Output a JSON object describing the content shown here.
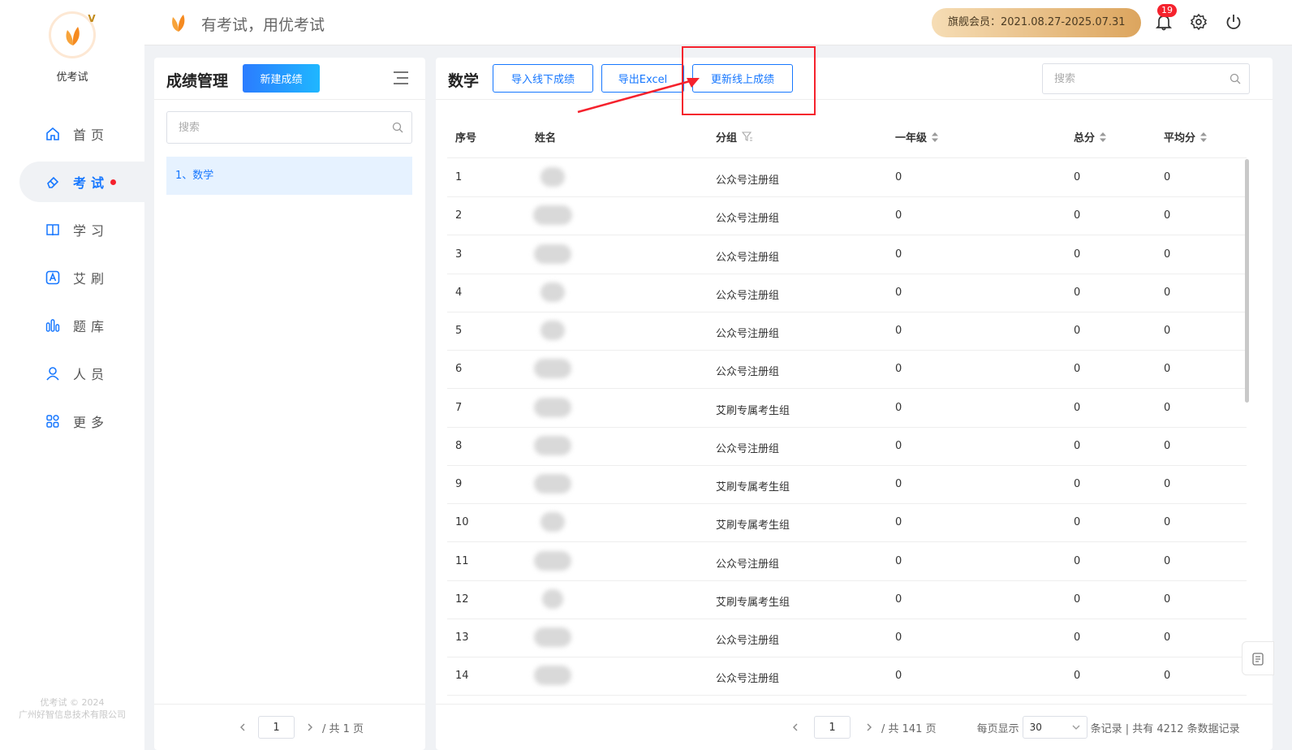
{
  "app": {
    "name": "优考试",
    "slogan": "有考试，用优考试",
    "logo_badge": "V"
  },
  "sidebar": {
    "items": [
      {
        "label": "首页",
        "icon": "home-icon"
      },
      {
        "label": "考试",
        "icon": "eraser-icon",
        "active": true,
        "dot": true
      },
      {
        "label": "学习",
        "icon": "book-icon"
      },
      {
        "label": "艾刷",
        "icon": "a-badge-icon"
      },
      {
        "label": "题库",
        "icon": "bars-icon"
      },
      {
        "label": "人员",
        "icon": "user-icon"
      },
      {
        "label": "更多",
        "icon": "apps-icon"
      }
    ],
    "footer_line1": "优考试 © 2024",
    "footer_line2": "广州好智信息技术有限公司"
  },
  "topbar": {
    "member_text": "旗舰会员：2021.08.27-2025.07.31",
    "notification_count": "19"
  },
  "left_panel": {
    "title": "成绩管理",
    "new_button": "新建成绩",
    "search_placeholder": "搜索",
    "exam_list": [
      "1、数学"
    ],
    "pager": {
      "page": "1",
      "total": "/ 共 1 页"
    }
  },
  "right_panel": {
    "title": "数学",
    "buttons": {
      "import": "导入线下成绩",
      "export": "导出Excel",
      "update": "更新线上成绩"
    },
    "search_placeholder": "搜索",
    "columns": [
      "序号",
      "姓名",
      "分组",
      "一年级",
      "总分",
      "平均分"
    ],
    "rows": [
      {
        "no": "1",
        "group": "公众号注册组",
        "grade1": "0",
        "total": "0",
        "avg": "0"
      },
      {
        "no": "2",
        "group": "公众号注册组",
        "grade1": "0",
        "total": "0",
        "avg": "0"
      },
      {
        "no": "3",
        "group": "公众号注册组",
        "grade1": "0",
        "total": "0",
        "avg": "0"
      },
      {
        "no": "4",
        "group": "公众号注册组",
        "grade1": "0",
        "total": "0",
        "avg": "0"
      },
      {
        "no": "5",
        "group": "公众号注册组",
        "grade1": "0",
        "total": "0",
        "avg": "0"
      },
      {
        "no": "6",
        "group": "公众号注册组",
        "grade1": "0",
        "total": "0",
        "avg": "0"
      },
      {
        "no": "7",
        "group": "艾刷专属考生组",
        "grade1": "0",
        "total": "0",
        "avg": "0"
      },
      {
        "no": "8",
        "group": "公众号注册组",
        "grade1": "0",
        "total": "0",
        "avg": "0"
      },
      {
        "no": "9",
        "group": "艾刷专属考生组",
        "grade1": "0",
        "total": "0",
        "avg": "0"
      },
      {
        "no": "10",
        "group": "艾刷专属考生组",
        "grade1": "0",
        "total": "0",
        "avg": "0"
      },
      {
        "no": "11",
        "group": "公众号注册组",
        "grade1": "0",
        "total": "0",
        "avg": "0"
      },
      {
        "no": "12",
        "group": "艾刷专属考生组",
        "grade1": "0",
        "total": "0",
        "avg": "0"
      },
      {
        "no": "13",
        "group": "公众号注册组",
        "grade1": "0",
        "total": "0",
        "avg": "0"
      },
      {
        "no": "14",
        "group": "公众号注册组",
        "grade1": "0",
        "total": "0",
        "avg": "0"
      }
    ],
    "pager": {
      "page": "1",
      "total": "/ 共 141 页",
      "per_page_label": "每页显示",
      "per_page": "30",
      "summary": "条记录 | 共有 4212 条数据记录"
    }
  },
  "colors": {
    "primary": "#1677ff",
    "highlight_box": "#f5222d",
    "badge": "#f5222d"
  }
}
